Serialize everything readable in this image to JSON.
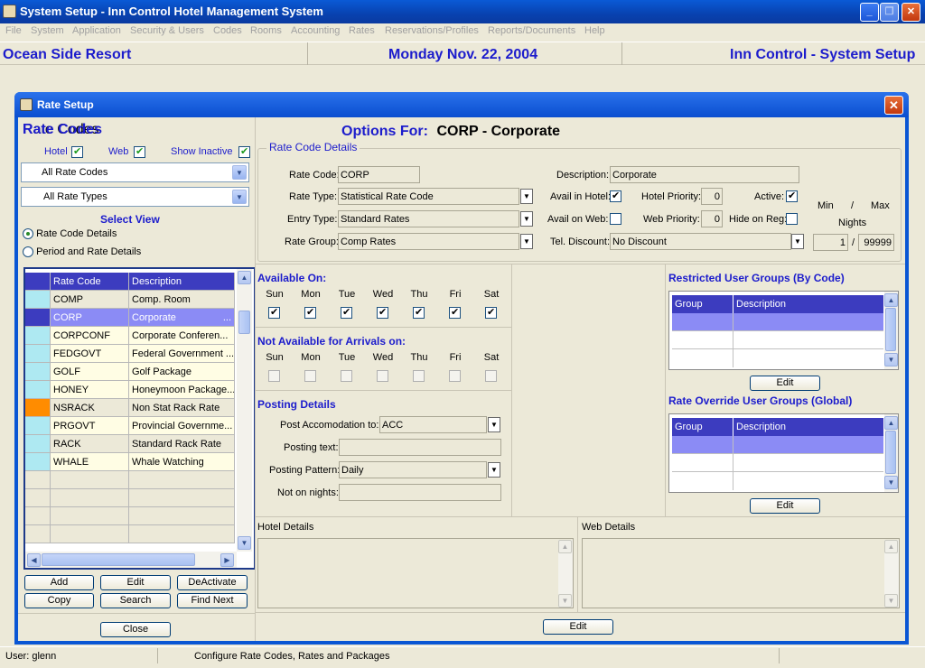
{
  "window": {
    "title": "System Setup - Inn Control Hotel Management System"
  },
  "menu": [
    "File",
    "System",
    "Application",
    "Security & Users",
    "Codes",
    "Rooms",
    "Accounting",
    "Rates",
    "Reservations/Profiles",
    "Reports/Documents",
    "Help"
  ],
  "header": {
    "property": "Ocean Side Resort",
    "date": "Monday Nov. 22, 2004",
    "module": "Inn Control - System Setup"
  },
  "dialog": {
    "title": "Rate Setup"
  },
  "left": {
    "heading": "Rate Codes",
    "hotel_label": "Hotel",
    "web_label": "Web",
    "show_inactive_label": "Show Inactive",
    "filter1": "All Rate Codes",
    "filter2": "All Rate Types",
    "select_view": "Select View",
    "radio1": "Rate Code Details",
    "radio2": "Period and Rate Details",
    "col_code": "Rate Code",
    "col_desc": "Description",
    "rows": [
      {
        "code": "COMP",
        "desc": "Comp. Room"
      },
      {
        "code": "CORP",
        "desc": "Corporate"
      },
      {
        "code": "CORPCONF",
        "desc": "Corporate Conferen..."
      },
      {
        "code": "FEDGOVT",
        "desc": "Federal Government ..."
      },
      {
        "code": "GOLF",
        "desc": "Golf Package"
      },
      {
        "code": "HONEY",
        "desc": "Honeymoon Package..."
      },
      {
        "code": "NSRACK",
        "desc": "Non Stat Rack Rate"
      },
      {
        "code": "PRGOVT",
        "desc": "Provincial Governme..."
      },
      {
        "code": "RACK",
        "desc": "Standard Rack Rate"
      },
      {
        "code": "WHALE",
        "desc": "Whale Watching"
      }
    ],
    "ellipsis": "...",
    "buttons": {
      "add": "Add",
      "edit": "Edit",
      "deactivate": "DeActivate",
      "copy": "Copy",
      "search": "Search",
      "find_next": "Find Next",
      "close": "Close"
    }
  },
  "options": {
    "prefix": "Options For:",
    "value": "CORP - Corporate"
  },
  "details": {
    "legend": "Rate Code Details",
    "rate_code_label": "Rate Code:",
    "rate_code": "CORP",
    "rate_type_label": "Rate Type:",
    "rate_type": "Statistical Rate Code",
    "entry_type_label": "Entry Type:",
    "entry_type": "Standard Rates",
    "rate_group_label": "Rate Group:",
    "rate_group": "Comp Rates",
    "description_label": "Description:",
    "description": "Corporate",
    "avail_hotel_label": "Avail in Hotel:",
    "avail_web_label": "Avail on Web:",
    "tel_discount_label": "Tel. Discount:",
    "tel_discount": "No Discount",
    "hotel_priority_label": "Hotel Priority:",
    "hotel_priority": "0",
    "web_priority_label": "Web Priority:",
    "web_priority": "0",
    "active_label": "Active:",
    "hide_reg_label": "Hide on Reg:",
    "min_label": "Min",
    "slash": "/",
    "max_label": "Max",
    "nights_label": "Nights",
    "min_nights": "1",
    "max_nights": "99999"
  },
  "available_on": {
    "title": "Available On:",
    "days": [
      "Sun",
      "Mon",
      "Tue",
      "Wed",
      "Thu",
      "Fri",
      "Sat"
    ]
  },
  "not_available": {
    "title": "Not Available for Arrivals on:"
  },
  "posting": {
    "title": "Posting Details",
    "post_label": "Post Accomodation to:",
    "post_value": "ACC",
    "text_label": "Posting text:",
    "pattern_label": "Posting Pattern:",
    "pattern_value": "Daily",
    "nights_label": "Not on nights:"
  },
  "restricted": {
    "title": "Restricted User Groups (By Code)",
    "col_group": "Group",
    "col_desc": "Description",
    "edit": "Edit"
  },
  "override": {
    "title": "Rate Override User Groups (Global)",
    "col_group": "Group",
    "col_desc": "Description",
    "edit": "Edit"
  },
  "hotel_details": "Hotel Details",
  "web_details": "Web Details",
  "bottom_edit": "Edit",
  "status": {
    "user": "User: glenn",
    "message": "Configure Rate Codes, Rates and Packages"
  },
  "colors": {
    "accent": "#1c1ccc",
    "selected_row": "#8b8bf5",
    "orange": "#ff8c00",
    "cyan": "#aee9f2"
  }
}
